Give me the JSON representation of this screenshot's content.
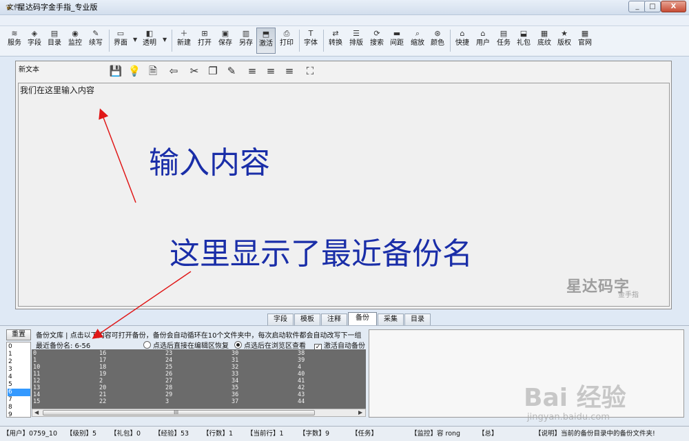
{
  "window": {
    "title": "星达码字金手指_专业版",
    "min": "_",
    "max": "□",
    "close": "X"
  },
  "menu": {
    "file": "文件"
  },
  "toolbar": {
    "items": [
      {
        "label": "服务",
        "icon": "≋"
      },
      {
        "label": "字段",
        "icon": "◈"
      },
      {
        "label": "目录",
        "icon": "▤"
      },
      {
        "label": "监控",
        "icon": "◉"
      },
      {
        "label": "续写",
        "icon": "✎"
      },
      {
        "label": "界面",
        "icon": "▭"
      },
      {
        "label": "透明",
        "icon": "◧"
      },
      {
        "label": "新建",
        "icon": "＋"
      },
      {
        "label": "打开",
        "icon": "⊞"
      },
      {
        "label": "保存",
        "icon": "▣"
      },
      {
        "label": "另存",
        "icon": "▥"
      },
      {
        "label": "激活",
        "icon": "⬒"
      },
      {
        "label": "打印",
        "icon": "⎙"
      },
      {
        "label": "字体",
        "icon": "T"
      },
      {
        "label": "转换",
        "icon": "⇄"
      },
      {
        "label": "排版",
        "icon": "☰"
      },
      {
        "label": "搜索",
        "icon": "⟳"
      },
      {
        "label": "间距",
        "icon": "▬"
      },
      {
        "label": "缩放",
        "icon": "⌕"
      },
      {
        "label": "颜色",
        "icon": "⊛"
      },
      {
        "label": "快捷",
        "icon": "⌂"
      },
      {
        "label": "用户",
        "icon": "⌂"
      },
      {
        "label": "任务",
        "icon": "▤"
      },
      {
        "label": "礼包",
        "icon": "⬓"
      },
      {
        "label": "底纹",
        "icon": "▦"
      },
      {
        "label": "版权",
        "icon": "★"
      },
      {
        "label": "官网",
        "icon": "▦"
      }
    ],
    "dropdown_arrow": "▼"
  },
  "editor": {
    "doc_name": "新文本",
    "tools": [
      "💾",
      "💡",
      "🗎",
      "⇦",
      "✂",
      "❐",
      "✎",
      "≡",
      "≡",
      "≡",
      "⛶"
    ],
    "content": "我们在这里输入内容"
  },
  "annotations": {
    "input_hint": "输入内容",
    "backup_hint": "这里显示了最近备份名"
  },
  "watermark": {
    "brand": "星达码字",
    "sub": "金手指"
  },
  "tabs": [
    "字段",
    "模板",
    "注释",
    "备份",
    "采集",
    "目录"
  ],
  "backup": {
    "reset": "重置",
    "description": "备份文库 | 点击以下内容可打开备份，备份会自动循环在10个文件夹中，每次启动软件都会自动改写下一组",
    "recent_label": "最近备份名: 6-56",
    "option_restore": "点选后直接在编辑区恢复",
    "option_preview": "点选后在浏览区查看",
    "option_autosave": "激活自动备份",
    "check_mark": "✓",
    "index_list": [
      "0",
      "1",
      "2",
      "3",
      "4",
      "5",
      "6",
      "7",
      "8",
      "9"
    ],
    "grid": [
      [
        "0",
        "16",
        "23",
        "30",
        "38"
      ],
      [
        "1",
        "17",
        "24",
        "31",
        "39"
      ],
      [
        "10",
        "18",
        "25",
        "32",
        "4"
      ],
      [
        "11",
        "19",
        "26",
        "33",
        "40"
      ],
      [
        "12",
        "2",
        "27",
        "34",
        "41"
      ],
      [
        "13",
        "20",
        "28",
        "35",
        "42"
      ],
      [
        "14",
        "21",
        "29",
        "36",
        "43"
      ],
      [
        "15",
        "22",
        "3",
        "37",
        "44"
      ]
    ],
    "scroll_grip": "III",
    "scroll_left": "◀",
    "scroll_right": "▶"
  },
  "baidu_watermark": {
    "main": "Bai 经验",
    "url": "jingyan.baidu.com"
  },
  "status": [
    "【用户】0759_10",
    "【级别】5",
    "【礼包】0",
    "【经验】53",
    "【行数】1",
    "【当前行】1",
    "【字数】9",
    "【任务】",
    "【监控】容 rong",
    "【总】",
    "【说明】当前的备份目录中的备份文件夹!"
  ]
}
